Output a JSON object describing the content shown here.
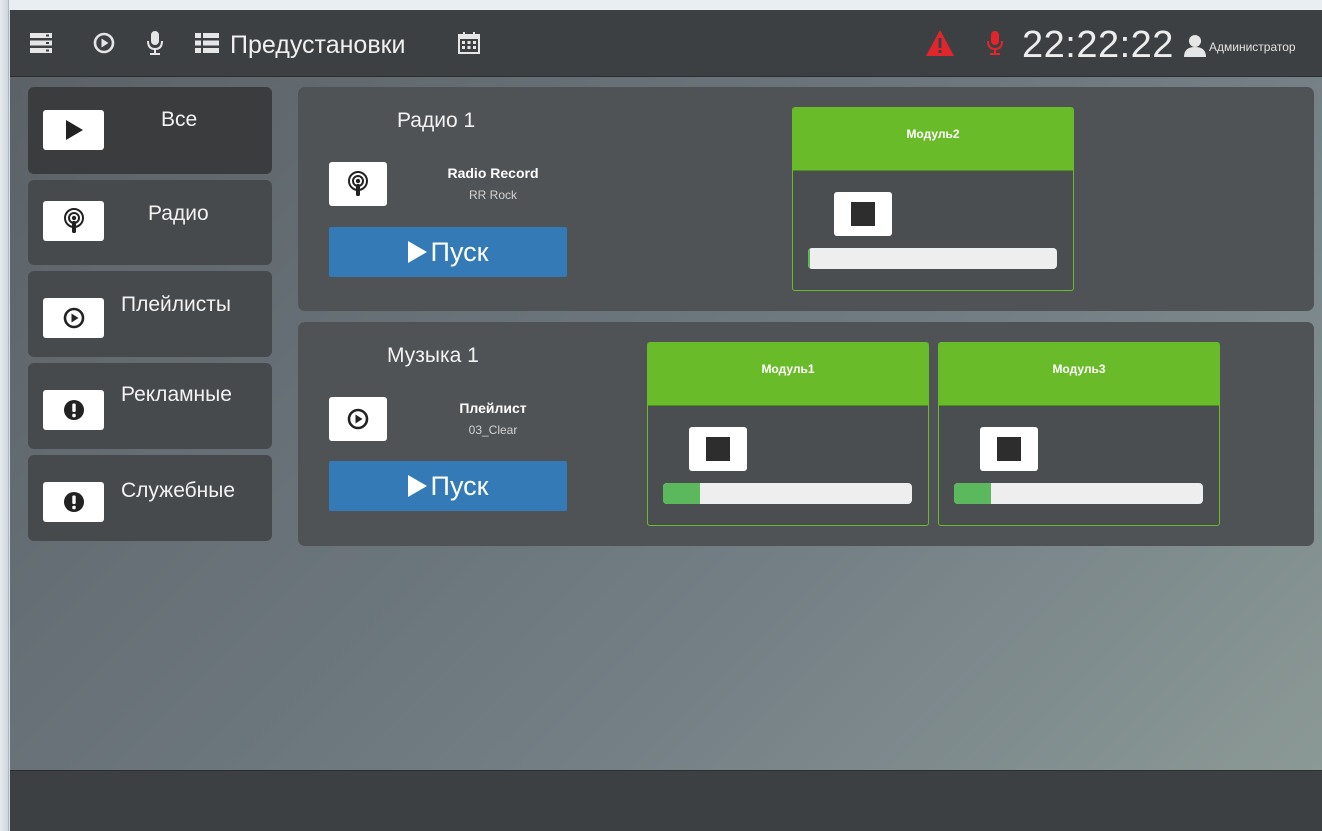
{
  "topbar": {
    "presets_label": "Предустановки",
    "clock": "22:22:22",
    "user": "Администратор",
    "icons": [
      "server-icon",
      "play-circle-icon",
      "microphone-icon",
      "list-icon",
      "calendar-icon",
      "warning-icon",
      "microphone-red-icon",
      "user-icon"
    ]
  },
  "sidebar": {
    "items": [
      {
        "label": "Все",
        "icon": "play-icon",
        "active": true
      },
      {
        "label": "Радио",
        "icon": "podcast-icon"
      },
      {
        "label": "Плейлисты",
        "icon": "play-circle-icon"
      },
      {
        "label": "Рекламные",
        "icon": "exclamation-circle-icon"
      },
      {
        "label": "Служебные",
        "icon": "exclamation-circle-icon"
      }
    ]
  },
  "panels": [
    {
      "title": "Радио 1",
      "source_name": "Radio Record",
      "source_sub": "RR Rock",
      "source_icon": "podcast-icon",
      "start_label": "Пуск",
      "modules": [
        {
          "name": "Модуль2",
          "progress": 0.01
        }
      ]
    },
    {
      "title": "Музыка 1",
      "source_name": "Плейлист",
      "source_sub": "03_Clear",
      "source_icon": "play-circle-icon",
      "start_label": "Пуск",
      "modules": [
        {
          "name": "Модуль1",
          "progress": 0.15
        },
        {
          "name": "Модуль3",
          "progress": 0.15
        }
      ]
    }
  ],
  "colors": {
    "accent_green": "#6abb2a",
    "primary_blue": "#337ab7",
    "progress_green": "#5cb85c",
    "alert_red": "#e0262c"
  }
}
